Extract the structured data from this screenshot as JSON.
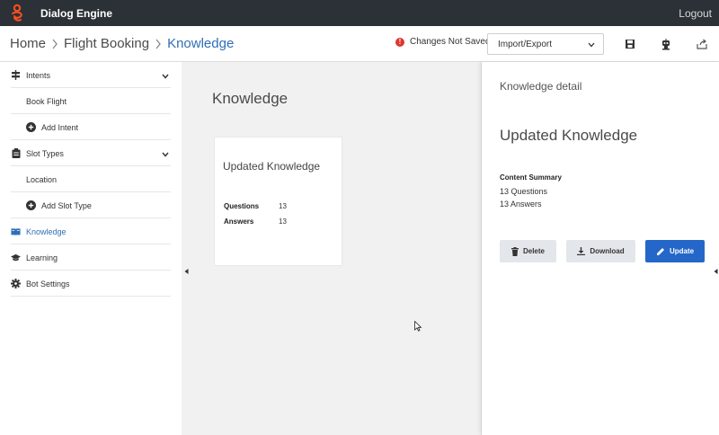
{
  "topbar": {
    "app_title": "Dialog Engine",
    "logout_label": "Logout"
  },
  "header": {
    "breadcrumb": [
      "Home",
      "Flight Booking",
      "Knowledge"
    ],
    "status_text": "Changes Not Saved",
    "status_mark": "!",
    "import_export": {
      "selected": "Import/Export"
    },
    "icons": [
      "save-icon",
      "robot-icon",
      "share-icon"
    ]
  },
  "sidebar": {
    "sections": [
      {
        "label": "Intents",
        "icon": "signpost-icon",
        "expanded": true,
        "items": [
          "Book Flight"
        ],
        "add_label": "Add Intent"
      },
      {
        "label": "Slot Types",
        "icon": "clipboard-icon",
        "expanded": true,
        "items": [
          "Location"
        ],
        "add_label": "Add Slot Type"
      }
    ],
    "links": [
      {
        "label": "Knowledge",
        "icon": "book-icon",
        "active": true
      },
      {
        "label": "Learning",
        "icon": "graduation-cap-icon",
        "active": false
      },
      {
        "label": "Bot Settings",
        "icon": "gear-icon",
        "active": false
      }
    ]
  },
  "main": {
    "title": "Knowledge",
    "card": {
      "title": "Updated Knowledge",
      "rows": [
        {
          "k": "Questions",
          "v": "13"
        },
        {
          "k": "Answers",
          "v": "13"
        }
      ]
    }
  },
  "detail": {
    "title": "Knowledge detail",
    "name": "Updated Knowledge",
    "summary_heading": "Content Summary",
    "summary_lines": [
      "13 Questions",
      "13 Answers"
    ],
    "buttons": {
      "delete": "Delete",
      "download": "Download",
      "update": "Update"
    }
  },
  "colors": {
    "accent": "#2467c8",
    "link": "#2f6fb5",
    "topbar": "#2b3136",
    "alert": "#e0362d",
    "brand": "#ff4f1f"
  }
}
